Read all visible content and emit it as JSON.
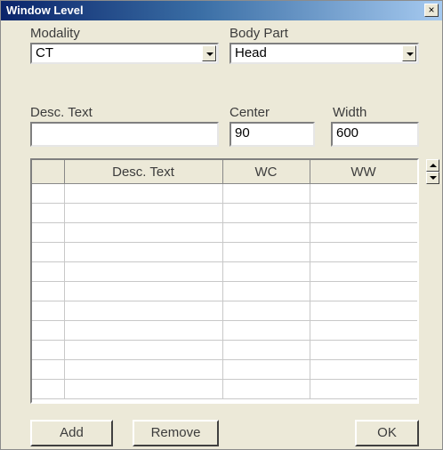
{
  "window": {
    "title": "Window Level",
    "close_glyph": "×"
  },
  "form": {
    "modality_label": "Modality",
    "modality_value": "CT",
    "body_part_label": "Body Part",
    "body_part_value": "Head",
    "desc_label": "Desc. Text",
    "desc_value": "",
    "center_label": "Center",
    "center_value": "90",
    "width_label": "Width",
    "width_value": "600"
  },
  "grid": {
    "columns": [
      "",
      "Desc. Text",
      "WC",
      "WW"
    ],
    "rows": [
      [
        "",
        "",
        "",
        ""
      ],
      [
        "",
        "",
        "",
        ""
      ],
      [
        "",
        "",
        "",
        ""
      ],
      [
        "",
        "",
        "",
        ""
      ],
      [
        "",
        "",
        "",
        ""
      ],
      [
        "",
        "",
        "",
        ""
      ],
      [
        "",
        "",
        "",
        ""
      ],
      [
        "",
        "",
        "",
        ""
      ],
      [
        "",
        "",
        "",
        ""
      ],
      [
        "",
        "",
        "",
        ""
      ],
      [
        "",
        "",
        "",
        ""
      ]
    ]
  },
  "buttons": {
    "add": "Add",
    "remove": "Remove",
    "ok": "OK"
  },
  "colors": {
    "titlebar_start": "#0a246a",
    "titlebar_end": "#a6caf0",
    "face": "#ece9d8"
  }
}
